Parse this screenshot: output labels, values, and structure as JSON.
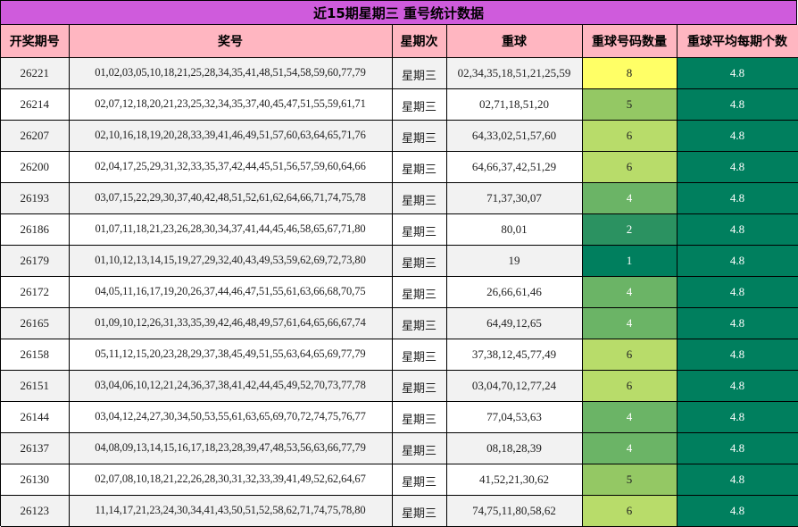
{
  "title": "近15期星期三 重号统计数据",
  "headers": [
    "开奖期号",
    "奖号",
    "星期次",
    "重球",
    "重球号码数量",
    "重球平均每期个数"
  ],
  "count_colors": {
    "8": "#ffff66",
    "6": "#b8dc6a",
    "5": "#94c864",
    "4": "#6bb466",
    "2": "#2b9261",
    "1": "#007f5e"
  },
  "count_text_colors": {
    "8": "#222222",
    "6": "#222222",
    "5": "#222222",
    "4": "#ffffff",
    "2": "#ffffff",
    "1": "#ffffff"
  },
  "rows": [
    {
      "issue": "26221",
      "numbers": "01,02,03,05,10,18,21,25,28,34,35,41,48,51,54,58,59,60,77,79",
      "weekday": "星期三",
      "repeats": "02,34,35,18,51,21,25,59",
      "count": "8",
      "avg": "4.8"
    },
    {
      "issue": "26214",
      "numbers": "02,07,12,18,20,21,23,25,32,34,35,37,40,45,47,51,55,59,61,71",
      "weekday": "星期三",
      "repeats": "02,71,18,51,20",
      "count": "5",
      "avg": "4.8"
    },
    {
      "issue": "26207",
      "numbers": "02,10,16,18,19,20,28,33,39,41,46,49,51,57,60,63,64,65,71,76",
      "weekday": "星期三",
      "repeats": "64,33,02,51,57,60",
      "count": "6",
      "avg": "4.8"
    },
    {
      "issue": "26200",
      "numbers": "02,04,17,25,29,31,32,33,35,37,42,44,45,51,56,57,59,60,64,66",
      "weekday": "星期三",
      "repeats": "64,66,37,42,51,29",
      "count": "6",
      "avg": "4.8"
    },
    {
      "issue": "26193",
      "numbers": "03,07,15,22,29,30,37,40,42,48,51,52,61,62,64,66,71,74,75,78",
      "weekday": "星期三",
      "repeats": "71,37,30,07",
      "count": "4",
      "avg": "4.8"
    },
    {
      "issue": "26186",
      "numbers": "01,07,11,18,21,23,26,28,30,34,37,41,44,45,46,58,65,67,71,80",
      "weekday": "星期三",
      "repeats": "80,01",
      "count": "2",
      "avg": "4.8"
    },
    {
      "issue": "26179",
      "numbers": "01,10,12,13,14,15,19,27,29,32,40,43,49,53,59,62,69,72,73,80",
      "weekday": "星期三",
      "repeats": "19",
      "count": "1",
      "avg": "4.8"
    },
    {
      "issue": "26172",
      "numbers": "04,05,11,16,17,19,20,26,37,44,46,47,51,55,61,63,66,68,70,75",
      "weekday": "星期三",
      "repeats": "26,66,61,46",
      "count": "4",
      "avg": "4.8"
    },
    {
      "issue": "26165",
      "numbers": "01,09,10,12,26,31,33,35,39,42,46,48,49,57,61,64,65,66,67,74",
      "weekday": "星期三",
      "repeats": "64,49,12,65",
      "count": "4",
      "avg": "4.8"
    },
    {
      "issue": "26158",
      "numbers": "05,11,12,15,20,23,28,29,37,38,45,49,51,55,63,64,65,69,77,79",
      "weekday": "星期三",
      "repeats": "37,38,12,45,77,49",
      "count": "6",
      "avg": "4.8"
    },
    {
      "issue": "26151",
      "numbers": "03,04,06,10,12,21,24,36,37,38,41,42,44,45,49,52,70,73,77,78",
      "weekday": "星期三",
      "repeats": "03,04,70,12,77,24",
      "count": "6",
      "avg": "4.8"
    },
    {
      "issue": "26144",
      "numbers": "03,04,12,24,27,30,34,50,53,55,61,63,65,69,70,72,74,75,76,77",
      "weekday": "星期三",
      "repeats": "77,04,53,63",
      "count": "4",
      "avg": "4.8"
    },
    {
      "issue": "26137",
      "numbers": "04,08,09,13,14,15,16,17,18,23,28,39,47,48,53,56,63,66,77,79",
      "weekday": "星期三",
      "repeats": "08,18,28,39",
      "count": "4",
      "avg": "4.8"
    },
    {
      "issue": "26130",
      "numbers": "02,07,08,10,18,21,22,26,28,30,31,32,33,39,41,49,52,62,64,67",
      "weekday": "星期三",
      "repeats": "41,52,21,30,62",
      "count": "5",
      "avg": "4.8"
    },
    {
      "issue": "26123",
      "numbers": "11,14,17,21,23,24,30,34,41,43,50,51,52,58,62,71,74,75,78,80",
      "weekday": "星期三",
      "repeats": "74,75,11,80,58,62",
      "count": "6",
      "avg": "4.8"
    }
  ]
}
